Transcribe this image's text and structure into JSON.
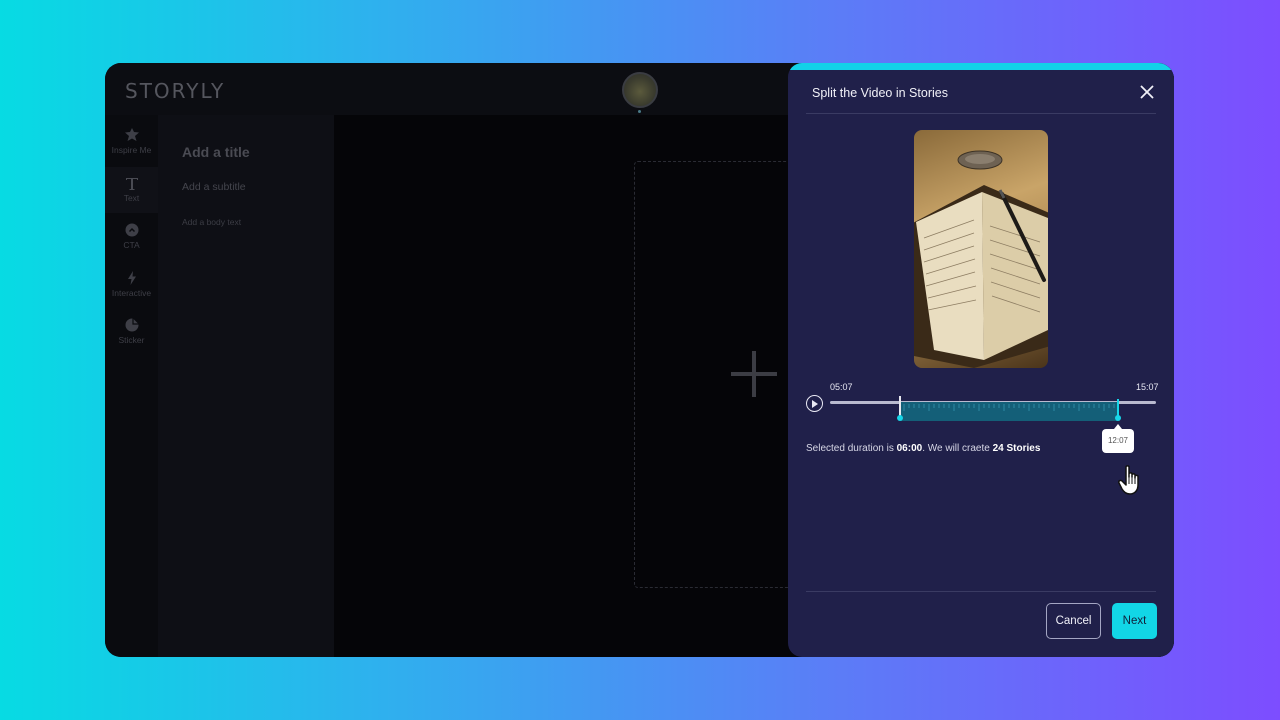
{
  "app": {
    "logo": "STORYLY"
  },
  "toolrail": {
    "items": [
      {
        "label": "Inspire Me",
        "icon": "star-burst-icon"
      },
      {
        "label": "Text",
        "icon": "text-t-icon"
      },
      {
        "label": "CTA",
        "icon": "cta-circle-icon"
      },
      {
        "label": "Interactive",
        "icon": "lightning-icon"
      },
      {
        "label": "Sticker",
        "icon": "sticker-icon"
      }
    ]
  },
  "text_panel": {
    "title": "Add a title",
    "subtitle": "Add a subtitle",
    "body": "Add a body text"
  },
  "modal": {
    "title": "Split the Video in Stories",
    "time_start": "05:07",
    "time_end": "15:07",
    "playhead_time": "12:07",
    "summary_prefix": "Selected duration is ",
    "summary_duration": "06:00",
    "summary_middle": ". We will craete ",
    "summary_count": "24 Stories",
    "cancel_label": "Cancel",
    "next_label": "Next",
    "selection_start_fraction": 0.22,
    "selection_end_fraction": 0.88,
    "accent_color": "#12d6e6",
    "background_color": "#20204a"
  }
}
